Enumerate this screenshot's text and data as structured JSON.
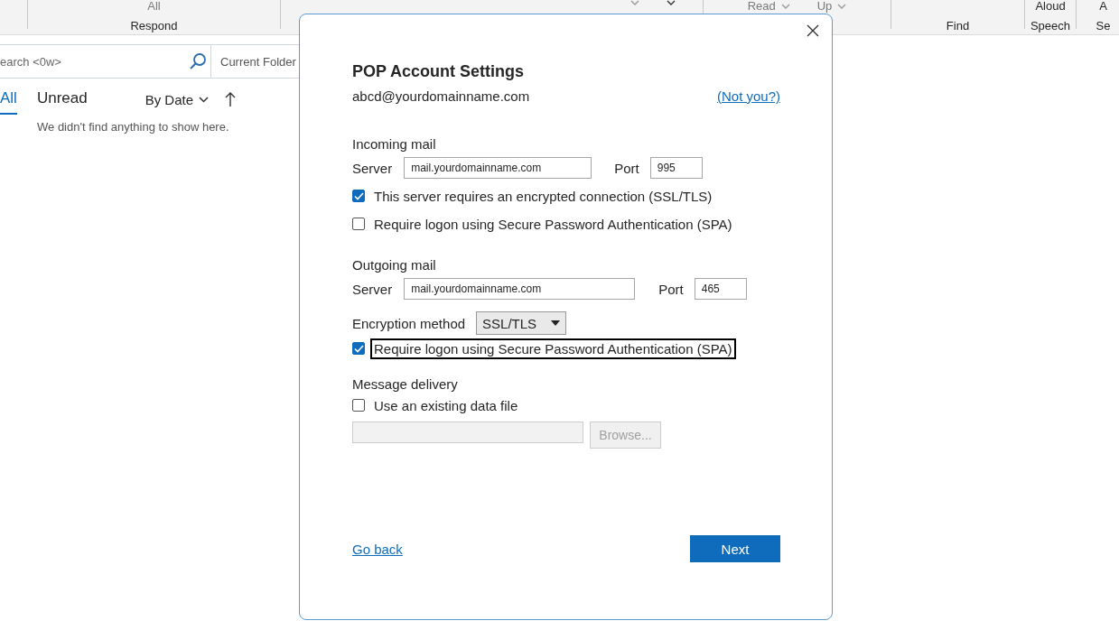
{
  "ribbon": {
    "groups": [
      {
        "commands": [
          {
            "label": "All",
            "disabled": true,
            "caret": false
          }
        ],
        "caption": "Respond"
      },
      {
        "commands": [
          {
            "disabled": true,
            "caret": true
          },
          {
            "disabled": false,
            "caret": true
          }
        ]
      },
      {
        "commands": [
          {
            "label": "Read",
            "disabled": true,
            "caret": true
          },
          {
            "label": "Up",
            "disabled": true,
            "caret": true
          }
        ]
      },
      {
        "caption": "Find"
      },
      {
        "commands": [
          {
            "label": "Aloud",
            "disabled": false,
            "caret": false
          }
        ],
        "caption": "Speech"
      },
      {
        "commands": [
          {
            "label": "A",
            "disabled": false,
            "caret": false
          }
        ],
        "caption": "Se"
      }
    ]
  },
  "message_list": {
    "search": {
      "placeholder": "earch <0w>"
    },
    "scope": "Current Folder",
    "tabs": [
      {
        "label": "All",
        "selected": true
      },
      {
        "label": "Unread",
        "selected": false
      }
    ],
    "sort": "By Date",
    "empty_text": "We didn't find anything to show here."
  },
  "dialog": {
    "title": "POP Account Settings",
    "email": "abcd@yourdomainname.com",
    "not_you": "(Not you?)",
    "incoming": {
      "heading": "Incoming mail",
      "server_label": "Server",
      "server": "mail.yourdomainname.com",
      "port_label": "Port",
      "port": "995",
      "options": [
        {
          "label": "This server requires an encrypted connection (SSL/TLS)",
          "checked": true,
          "focused": false
        },
        {
          "label": "Require logon using Secure Password Authentication (SPA)",
          "checked": false,
          "focused": false
        }
      ]
    },
    "outgoing": {
      "heading": "Outgoing mail",
      "server_label": "Server",
      "server": "mail.yourdomainname.com",
      "port_label": "Port",
      "port": "465",
      "encryption_label": "Encryption method",
      "encryption": "SSL/TLS",
      "options": [
        {
          "label": "Require logon using Secure Password Authentication (SPA)",
          "checked": true,
          "focused": true
        }
      ]
    },
    "delivery": {
      "heading": "Message delivery",
      "option": {
        "label": "Use an existing data file",
        "checked": false,
        "focused": false
      },
      "path_disabled": true,
      "browse": {
        "label": "Browse...",
        "disabled": true
      }
    },
    "back": "Go back",
    "next": "Next"
  }
}
